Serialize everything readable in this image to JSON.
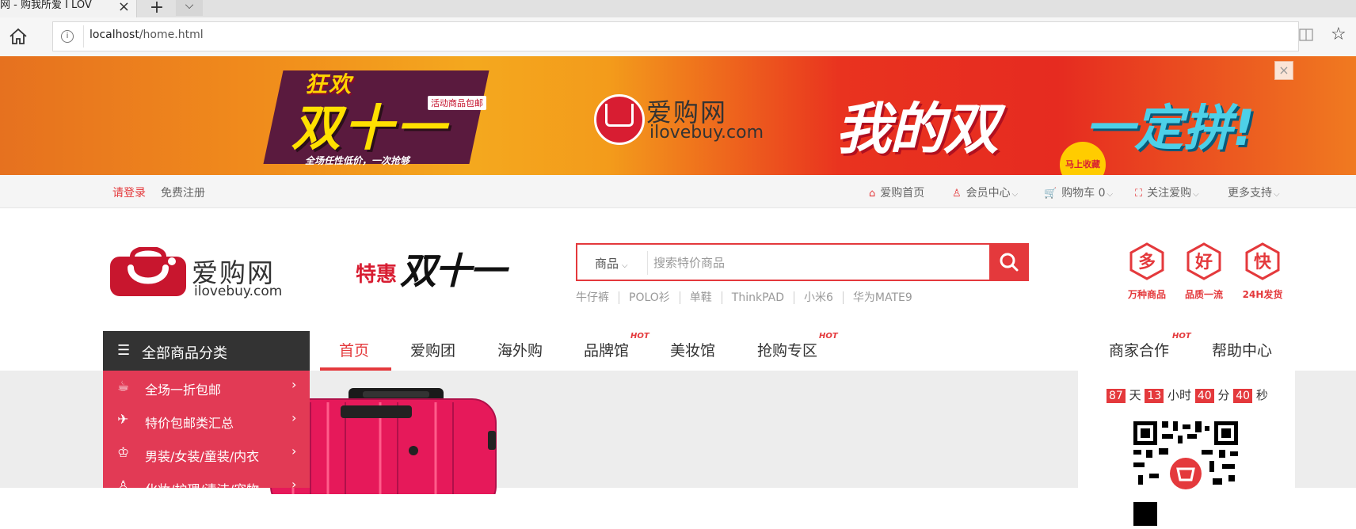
{
  "browser": {
    "tab_title": "网 - 购我所爱 I LOV",
    "tab_close": "×",
    "new_tab": "+",
    "tab_list": "⌵",
    "url_host": "localhost",
    "url_path": "/home.html"
  },
  "banner": {
    "kuanghuan": "狂欢",
    "shuang11": "双十一",
    "activity_tag": "活动商品包邮",
    "slogan": "全场任性低价，一次抢够",
    "logo_cn": "爱购网",
    "logo_en": "ilovebuy.com",
    "main_slogan": "我的双",
    "main_slogan_2": "一定拼!",
    "badge": "马上收藏",
    "close": "×"
  },
  "topbar": {
    "login": "请登录",
    "register": "免费注册",
    "home": "爱购首页",
    "member": "会员中心",
    "cart": "购物车 0",
    "follow": "关注爱购",
    "more": "更多支持"
  },
  "header": {
    "logo_cn": "爱购网",
    "logo_en": "ilovebuy.com",
    "promo_tehui": "特惠",
    "promo_shuang11": "双十一",
    "search_category": "商品",
    "search_placeholder": "搜索特价商品",
    "hot_words": [
      "牛仔裤",
      "POLO衫",
      "单鞋",
      "ThinkPAD",
      "小米6",
      "华为MATE9"
    ],
    "services": [
      {
        "char": "多",
        "label": "万种商品"
      },
      {
        "char": "好",
        "label": "品质一流"
      },
      {
        "char": "快",
        "label": "24H发货"
      }
    ]
  },
  "nav": {
    "all_categories": "全部商品分类",
    "items": [
      "首页",
      "爱购团",
      "海外购",
      "品牌馆",
      "美妆馆",
      "抢购专区"
    ],
    "right_items": [
      "商家合作",
      "帮助中心"
    ],
    "hot_tag": "HOT"
  },
  "categories": [
    {
      "icon": "☕",
      "label": "全场一折包邮"
    },
    {
      "icon": "✈",
      "label": "特价包邮类汇总"
    },
    {
      "icon": "♔",
      "label": "男装/女装/童装/内衣"
    },
    {
      "icon": "♙",
      "label": "化妆/护理/清洁/宠物"
    }
  ],
  "countdown": {
    "days": "87",
    "days_unit": "天",
    "hours": "13",
    "hours_unit": "小时",
    "minutes": "40",
    "minutes_unit": "分",
    "seconds": "40",
    "seconds_unit": "秒"
  },
  "colors": {
    "accent": "#e4393c",
    "category_bg": "#e23a55",
    "dark": "#333333"
  }
}
